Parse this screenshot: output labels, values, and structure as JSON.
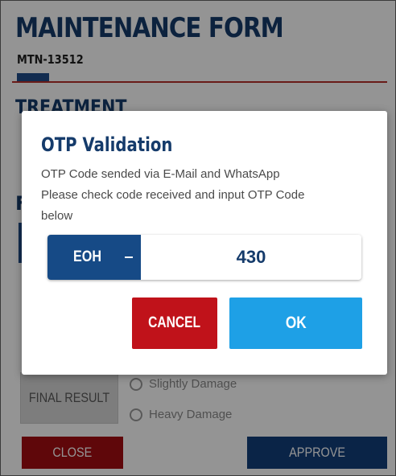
{
  "form": {
    "title": "MAINTENANCE FORM",
    "code": "MTN-13512",
    "section_heading": "TREATMENT",
    "section_letter": "F",
    "final_result_label": "FINAL RESULT",
    "radio_options": [
      "Slightly Damage",
      "Heavy Damage"
    ],
    "close_label": "CLOSE",
    "approve_label": "APPROVE"
  },
  "dialog": {
    "title": "OTP Validation",
    "message_lines": [
      "OTP Code sended via E-Mail and WhatsApp",
      "Please check code received and input OTP Code",
      "below"
    ],
    "otp_prefix": "EOH",
    "otp_value": "430",
    "cancel_label": "CANCEL",
    "ok_label": "OK"
  },
  "colors": {
    "brand_blue": "#153b6b",
    "accent_red": "#c0121a",
    "ok_blue": "#1ea0e6"
  }
}
